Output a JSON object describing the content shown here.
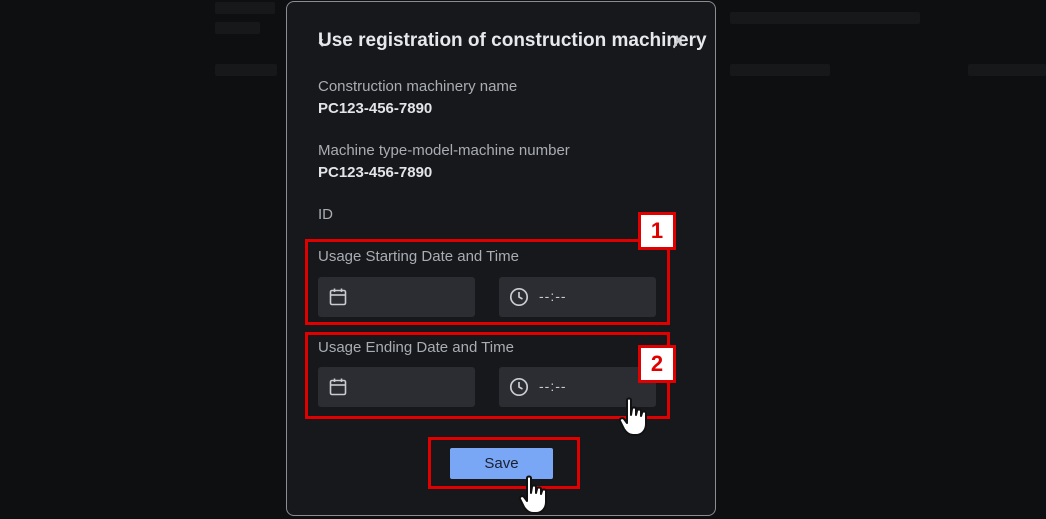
{
  "dialog": {
    "title": "Use registration of construction machinery",
    "machinery_name_label": "Construction machinery name",
    "machinery_name_value": "PC123-456-7890",
    "machine_number_label": "Machine type-model-machine number",
    "machine_number_value": "PC123-456-7890",
    "id_label": "ID",
    "start_label": "Usage Starting Date and Time",
    "end_label": "Usage Ending Date and Time",
    "time_placeholder": "--:--",
    "save_label": "Save"
  },
  "annotations": {
    "badge_1": "1",
    "badge_2": "2"
  },
  "icons": [
    "back-icon",
    "close-icon",
    "calendar-icon",
    "clock-icon",
    "hand-pointer-icon"
  ],
  "colors": {
    "accent": "#7aa7f5",
    "highlight": "#e00000",
    "field_bg": "#2b2d32",
    "modal_bg": "#17181b"
  }
}
